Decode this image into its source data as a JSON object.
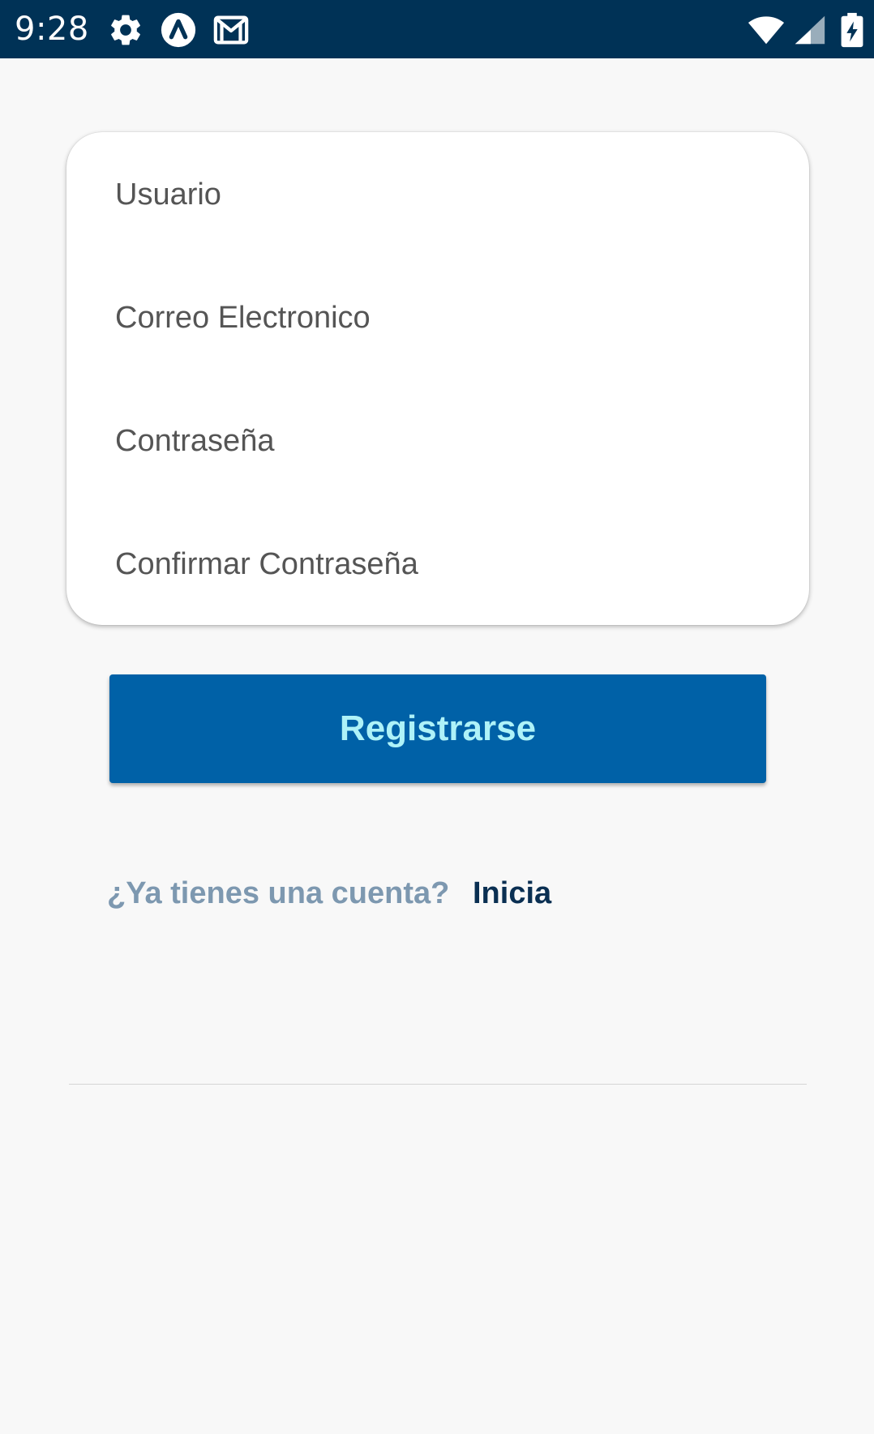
{
  "status_bar": {
    "time": "9:28",
    "left_icons": [
      "gear-icon",
      "app-a-icon",
      "gmail-icon"
    ],
    "right_icons": [
      "wifi-icon",
      "signal-icon",
      "battery-charging-icon"
    ],
    "background": "#003256"
  },
  "form": {
    "fields": [
      {
        "placeholder": "Usuario",
        "value": ""
      },
      {
        "placeholder": "Correo Electronico",
        "value": ""
      },
      {
        "placeholder": "Contraseña",
        "value": ""
      },
      {
        "placeholder": "Confirmar Contraseña",
        "value": ""
      }
    ]
  },
  "register_button": {
    "label": "Registrarse",
    "background": "#0061a7",
    "text_color": "#aef2f8"
  },
  "login": {
    "prompt": "¿Ya tienes una cuenta?",
    "link": "Inicia"
  }
}
